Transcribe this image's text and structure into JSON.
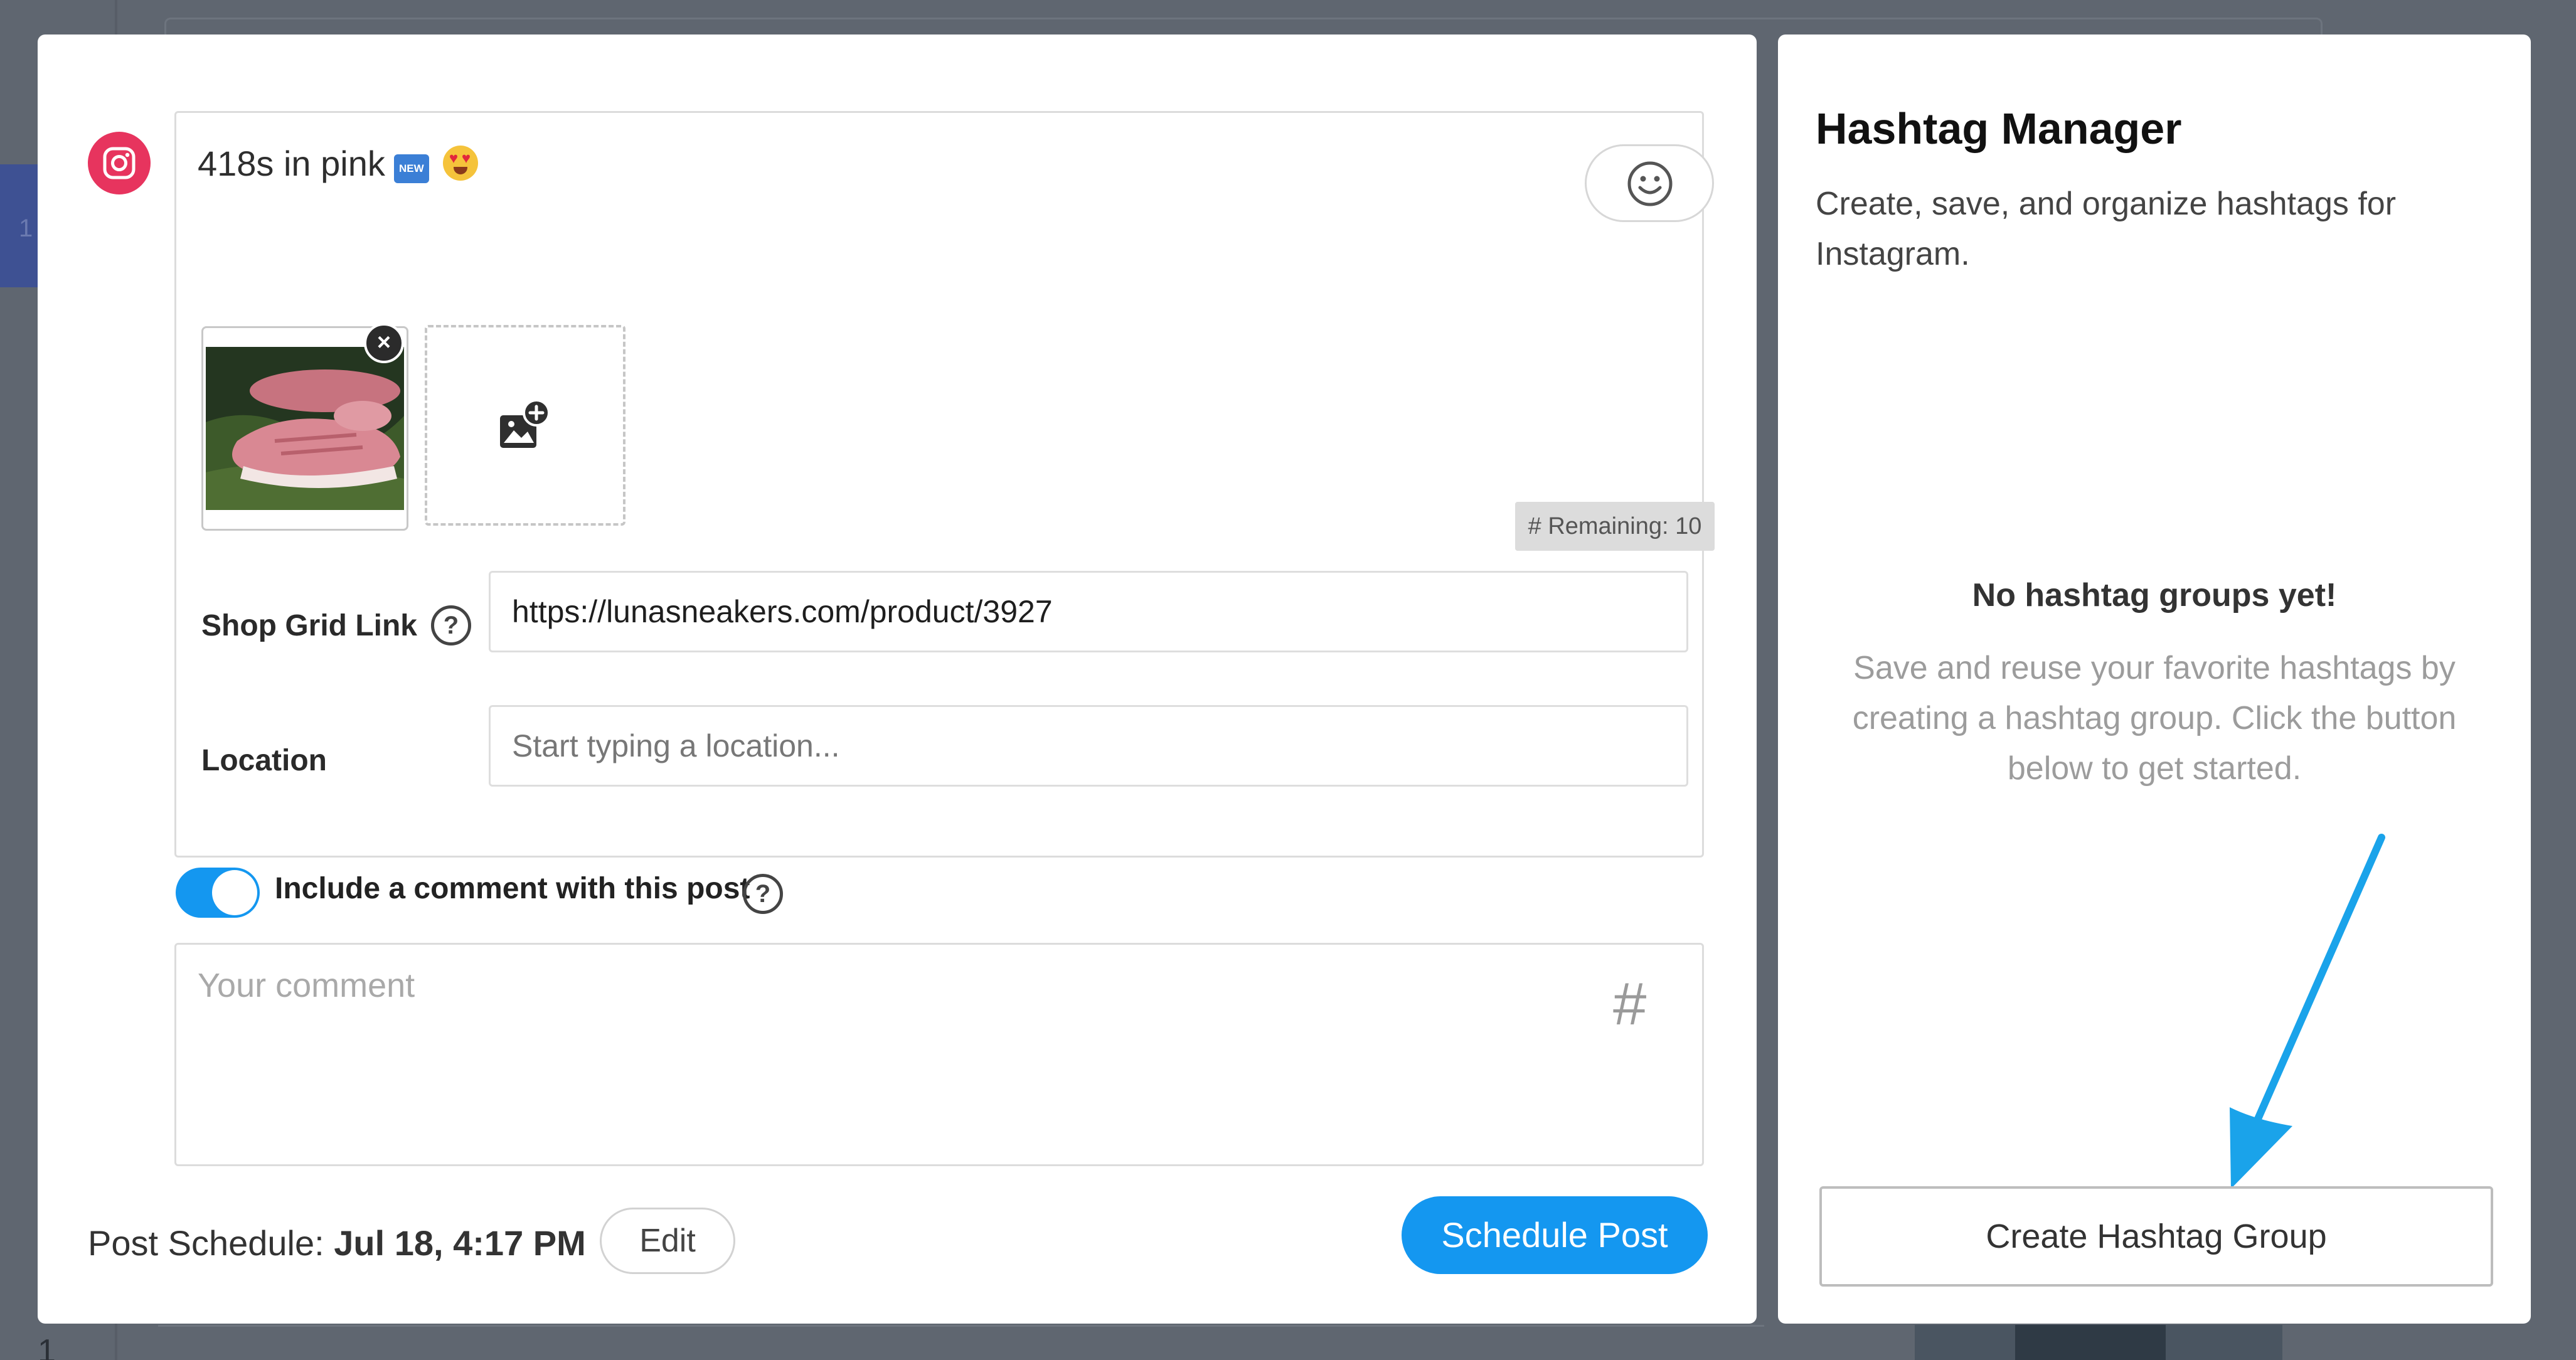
{
  "background": {
    "side_tab_number": "1",
    "bottom_left_number": "1"
  },
  "composer": {
    "network_icon": "instagram-icon",
    "caption_text": "418s in pink",
    "caption_badge": "NEW",
    "emoji_icon": "smiley-face-icon",
    "media": {
      "image": "pink-sneakers-photo",
      "remove_symbol": "×",
      "add_media_icon": "add-image-icon"
    },
    "remaining_label": "# Remaining: 10",
    "shop_grid": {
      "label": "Shop Grid Link",
      "help_symbol": "?",
      "value": "https://lunasneakers.com/product/3927"
    },
    "location": {
      "label": "Location",
      "placeholder": "Start typing a location..."
    },
    "comment_toggle": {
      "label": "Include a comment with this post",
      "enabled": true,
      "help_symbol": "?"
    },
    "comment": {
      "placeholder": "Your comment",
      "hash_symbol": "#"
    },
    "schedule": {
      "prefix": "Post Schedule: ",
      "datetime": "Jul 18, 4:17 PM",
      "edit_label": "Edit",
      "submit_label": "Schedule Post"
    }
  },
  "hashtag_manager": {
    "title": "Hashtag Manager",
    "subtitle": "Create, save, and organize hashtags for Instagram.",
    "empty_title": "No hashtag groups yet!",
    "empty_description": "Save and reuse your favorite hashtags by creating a hashtag group. Click the button below to get started.",
    "create_button": "Create Hashtag Group"
  },
  "colors": {
    "primary_blue": "#1497f0",
    "instagram_pink": "#e7345e",
    "overlay": "#5f6670"
  }
}
